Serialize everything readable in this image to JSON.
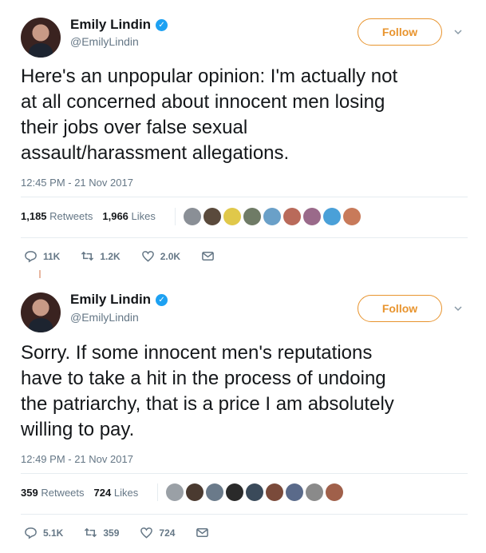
{
  "tweets": [
    {
      "author_name": "Emily Lindin",
      "handle": "@EmilyLindin",
      "follow_label": "Follow",
      "text_lines": [
        "Here's an unpopular opinion: I'm actually not",
        "at all concerned about innocent men losing",
        "their jobs over false sexual",
        "assault/harassment allegations."
      ],
      "timestamp": "12:45 PM - 21 Nov 2017",
      "retweets_count": "1,185",
      "retweets_label": "Retweets",
      "likes_count": "1,966",
      "likes_label": "Likes",
      "liker_colors": [
        "#8a8f96",
        "#5a4a3c",
        "#e0c84a",
        "#6f7b66",
        "#6aa0c8",
        "#b96a5a",
        "#9a6a8a",
        "#4aa0d8",
        "#c87a5a"
      ],
      "replies": "11K",
      "retweets_short": "1.2K",
      "likes_short": "2.0K"
    },
    {
      "author_name": "Emily Lindin",
      "handle": "@EmilyLindin",
      "follow_label": "Follow",
      "text_lines": [
        "Sorry. If some innocent men's reputations",
        "have to take a hit in the process of undoing",
        "the patriarchy, that is a price I am absolutely",
        "willing to pay."
      ],
      "timestamp": "12:49 PM - 21 Nov 2017",
      "retweets_count": "359",
      "retweets_label": "Retweets",
      "likes_count": "724",
      "likes_label": "Likes",
      "liker_colors": [
        "#9aa0a6",
        "#4a3a30",
        "#6a7a8a",
        "#2a2a2a",
        "#3a4a5a",
        "#7a4a3a",
        "#5a6a8a",
        "#8a8a8a",
        "#a0604a"
      ],
      "replies": "5.1K",
      "retweets_short": "359",
      "likes_short": "724"
    }
  ],
  "colors": {
    "accent": "#e8942e",
    "verified": "#1da1f2",
    "muted": "#657786",
    "text": "#14171a"
  },
  "icons": [
    "verified-badge-icon",
    "chevron-down-icon",
    "reply-icon",
    "retweet-icon",
    "like-icon",
    "message-icon"
  ]
}
